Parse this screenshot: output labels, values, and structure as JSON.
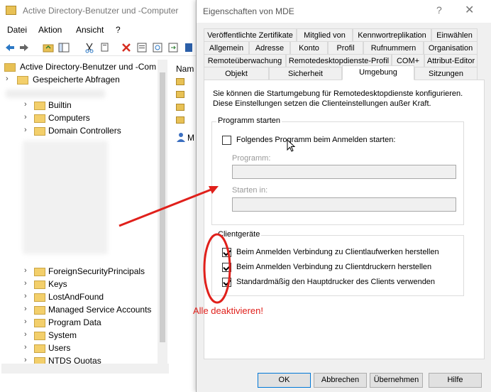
{
  "background_window": {
    "title": "Active Directory-Benutzer und -Computer",
    "menu": [
      "Datei",
      "Aktion",
      "Ansicht",
      "?"
    ],
    "tree": {
      "root": "Active Directory-Benutzer und -Com",
      "saved_queries": "Gespeicherte Abfragen",
      "items_top": [
        "Builtin",
        "Computers",
        "Domain Controllers"
      ],
      "items_bottom": [
        "ForeignSecurityPrincipals",
        "Keys",
        "LostAndFound",
        "Managed Service Accounts",
        "Program Data",
        "System",
        "Users",
        "NTDS Quotas"
      ]
    },
    "list": {
      "header": "Nam",
      "user_item": "M"
    }
  },
  "dialog": {
    "title": "Eigenschaften von MDE",
    "help_glyph": "?",
    "close_glyph": "✕",
    "tabs_row1": [
      "Veröffentlichte Zertifikate",
      "Mitglied von",
      "Kennwortreplikation",
      "Einwählen"
    ],
    "tabs_row2": [
      "Allgemein",
      "Adresse",
      "Konto",
      "Profil",
      "Rufnummern",
      "Organisation"
    ],
    "tabs_row3": [
      "Remoteüberwachung",
      "Remotedesktopdienste-Profil",
      "COM+",
      "Attribut-Editor"
    ],
    "tabs_row4": [
      "Objekt",
      "Sicherheit",
      "Umgebung",
      "Sitzungen"
    ],
    "active_tab": "Umgebung",
    "description": "Sie können die Startumgebung für Remotedesktopdienste konfigurieren. Diese Einstellungen setzen die Clienteinstellungen außer Kraft.",
    "program_group": {
      "legend": "Programm starten",
      "start_checkbox_label": "Folgendes Programm beim Anmelden starten:",
      "start_checked": false,
      "program_label": "Programm:",
      "program_value": "",
      "start_in_label": "Starten in:",
      "start_in_value": ""
    },
    "client_group": {
      "legend": "Clientgeräte",
      "options": [
        {
          "label": "Beim Anmelden Verbindung zu Clientlaufwerken herstellen",
          "checked": true
        },
        {
          "label": "Beim Anmelden Verbindung zu Clientdruckern herstellen",
          "checked": true
        },
        {
          "label": "Standardmäßig den Hauptdrucker des Clients verwenden",
          "checked": true
        }
      ]
    },
    "buttons": {
      "ok": "OK",
      "cancel": "Abbrechen",
      "apply": "Übernehmen",
      "help": "Hilfe"
    }
  },
  "annotation": {
    "note": "Alle deaktivieren!",
    "color": "#e0201b"
  }
}
